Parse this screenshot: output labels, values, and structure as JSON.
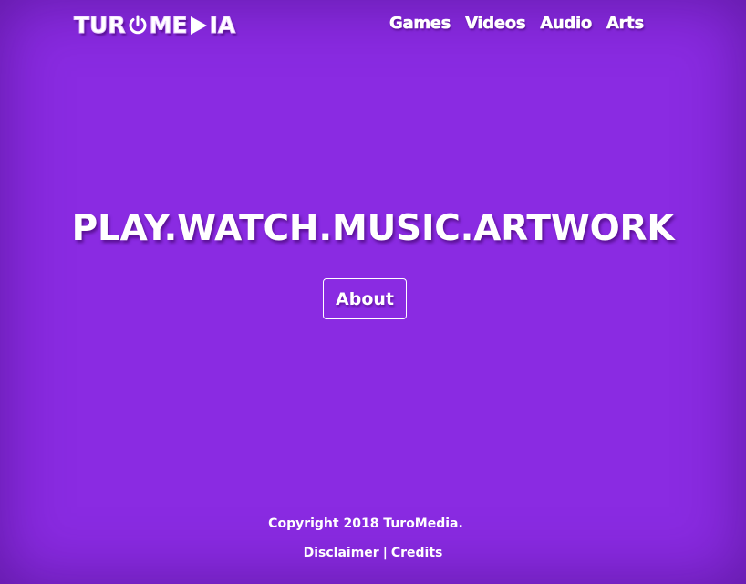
{
  "colors": {
    "background": "#8a2be2",
    "text": "#ffffff"
  },
  "logo": {
    "text_before": "TUR",
    "text_middle": "ME",
    "text_after": "IA",
    "icons": [
      "power-icon",
      "play-icon"
    ]
  },
  "nav": {
    "items": [
      {
        "label": "Games"
      },
      {
        "label": "Videos"
      },
      {
        "label": "Audio"
      },
      {
        "label": "Arts"
      }
    ]
  },
  "hero": {
    "title": "PLAY.WATCH.MUSIC.ARTWORK",
    "button_label": "About"
  },
  "footer": {
    "copyright": "Copyright 2018 TuroMedia.",
    "disclaimer_label": "Disclaimer",
    "separator": "|",
    "credits_label": "Credits"
  }
}
